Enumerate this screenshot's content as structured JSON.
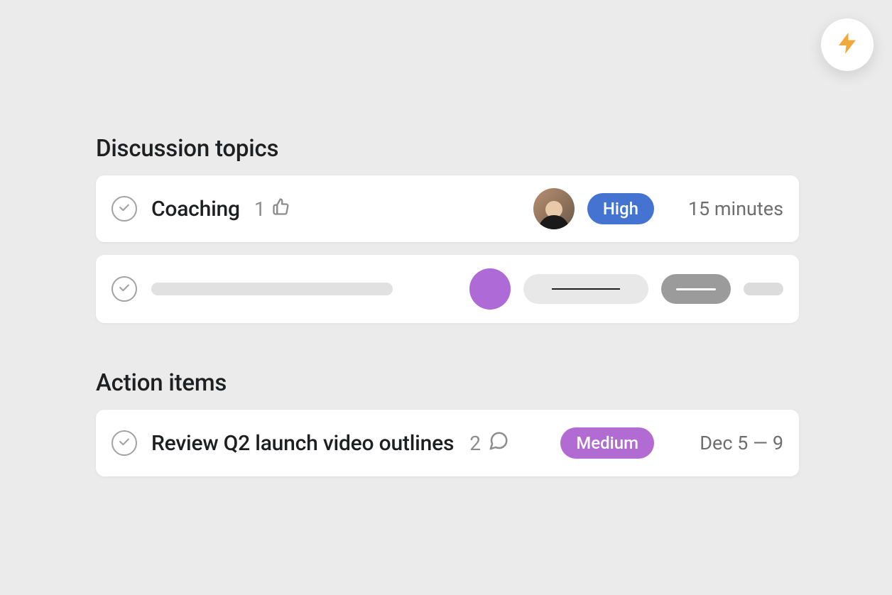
{
  "fab": {
    "icon_name": "lightning-bolt-icon"
  },
  "sections": {
    "discussion": {
      "title": "Discussion topics",
      "rows": [
        {
          "title": "Coaching",
          "like_count": "1",
          "priority_label": "High",
          "priority_color": "#4573d2",
          "duration": "15 minutes"
        }
      ],
      "placeholder_row": {
        "avatar_color": "#ae6ad6"
      }
    },
    "action_items": {
      "title": "Action items",
      "rows": [
        {
          "title": "Review Q2 launch video outlines",
          "comment_count": "2",
          "priority_label": "Medium",
          "priority_color": "#b36bd4",
          "date_range": "Dec 5 — 9"
        }
      ]
    }
  }
}
